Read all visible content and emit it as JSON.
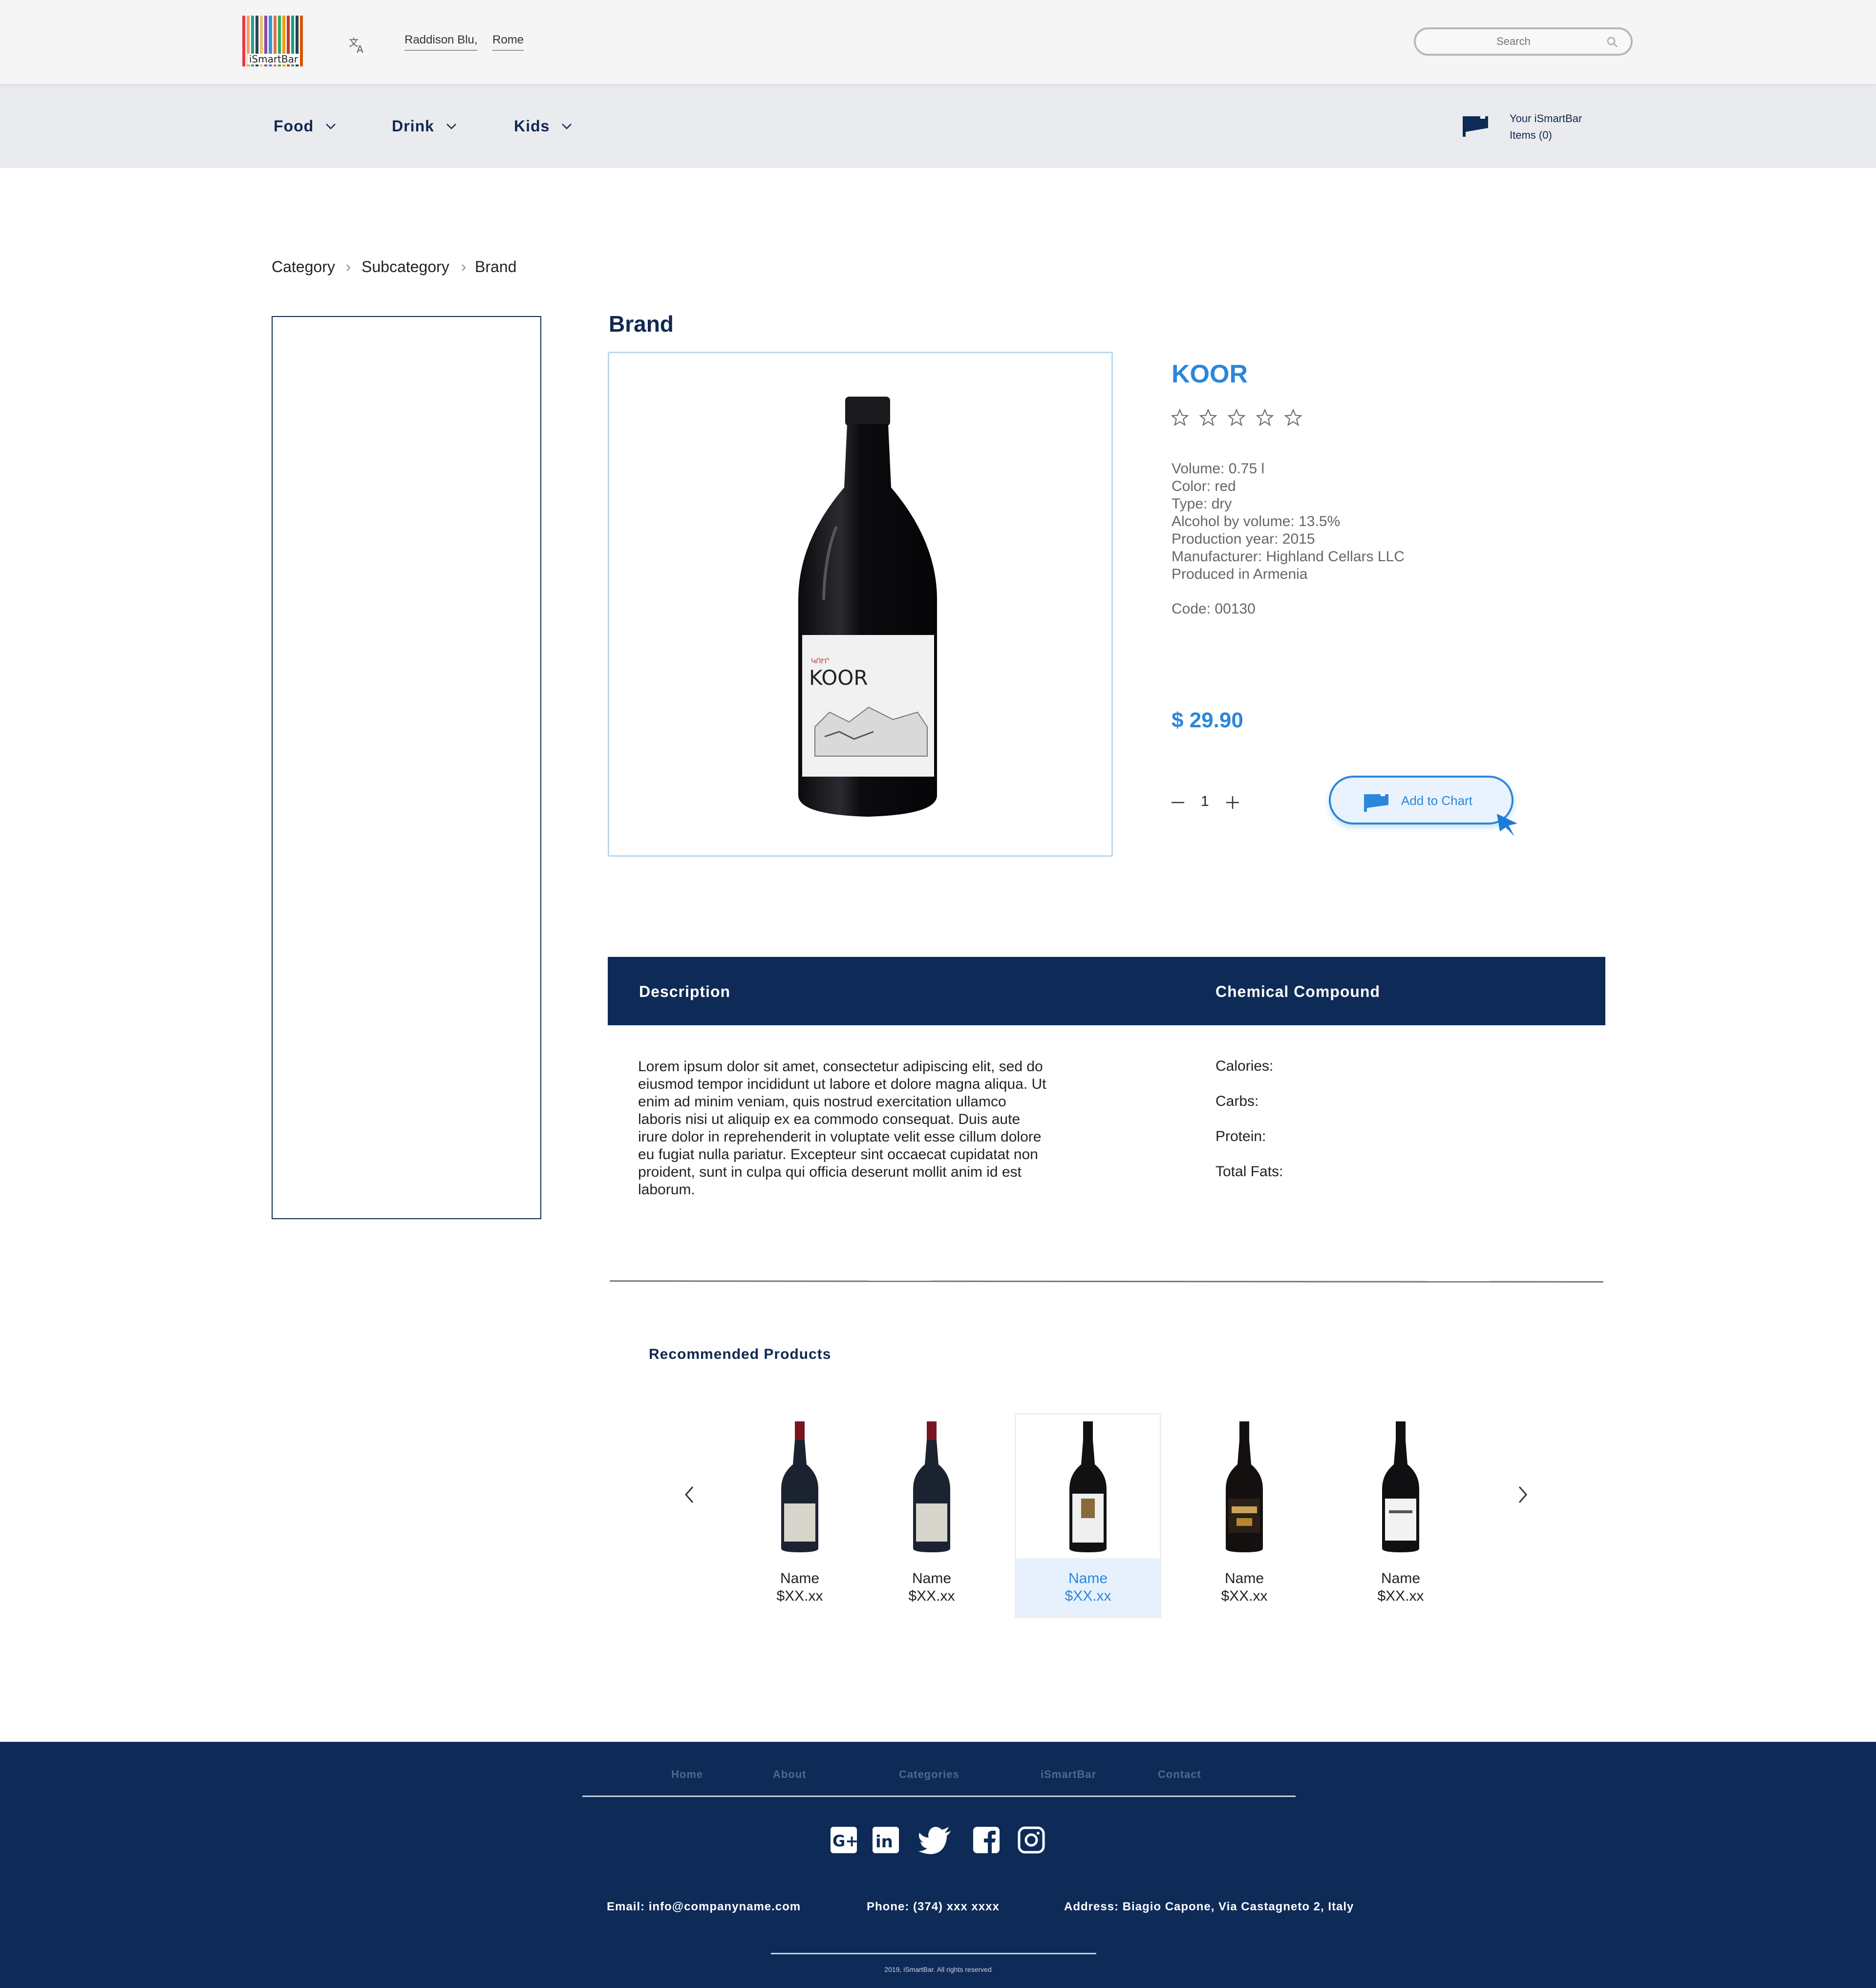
{
  "header": {
    "logo_text": "iSmartBar",
    "location_hotel": "Raddison Blu,",
    "location_city": "Rome",
    "search_placeholder": "Search"
  },
  "nav": {
    "items": [
      {
        "label": "Food"
      },
      {
        "label": "Drink"
      },
      {
        "label": "Kids"
      }
    ],
    "cart_title": "Your iSmartBar",
    "cart_items": "Items (0)"
  },
  "breadcrumb": [
    "Category",
    "Subcategory",
    "Brand"
  ],
  "product": {
    "brand_heading": "Brand",
    "name": "KOOR",
    "rating": 0,
    "rating_max": 5,
    "specs": [
      "Volume: 0.75 l",
      "Color: red",
      "Type: dry",
      "Alcohol by volume: 13.5%",
      "Production year: 2015",
      "Manufacturer: Highland Cellars LLC",
      "Produced in Armenia"
    ],
    "code": "Code: 00130",
    "price": "$ 29.90",
    "quantity": "1",
    "add_button": "Add to Chart",
    "label_brand": "KOOR"
  },
  "tabs": {
    "description_label": "Description",
    "chemical_label": "Chemical Compound",
    "description_text": "Lorem ipsum dolor sit amet, consectetur adipiscing elit, sed do eiusmod tempor incididunt ut labore et dolore magna aliqua. Ut enim ad minim veniam, quis nostrud exercitation ullamco laboris nisi ut aliquip ex ea commodo consequat. Duis aute irure dolor in reprehenderit in voluptate velit esse cillum dolore eu fugiat nulla pariatur. Excepteur sint occaecat cupidatat non proident, sunt in culpa qui officia deserunt mollit anim id est laborum.",
    "chemical": [
      "Calories:",
      "Carbs:",
      "Protein:",
      "Total Fats:"
    ]
  },
  "recommended": {
    "title": "Recommended Products",
    "items": [
      {
        "name": "Name",
        "price": "$XX.xx",
        "active": false
      },
      {
        "name": "Name",
        "price": "$XX.xx",
        "active": false
      },
      {
        "name": "Name",
        "price": "$XX.xx",
        "active": true
      },
      {
        "name": "Name",
        "price": "$XX.xx",
        "active": false
      },
      {
        "name": "Name",
        "price": "$XX.xx",
        "active": false
      }
    ]
  },
  "footer": {
    "links": [
      "Home",
      "About",
      "Categories",
      "iSmartBar",
      "Contact"
    ],
    "social_icons": [
      "google-plus-icon",
      "linkedin-icon",
      "twitter-icon",
      "facebook-icon",
      "instagram-icon"
    ],
    "email": "Email: info@companyname.com",
    "phone": "Phone: (374) xxx xxxx",
    "address": "Address: Biagio Capone, Via Castagneto 2, Italy",
    "copyright": "2019, iSmartBar. All rights reserved"
  },
  "colors": {
    "navy": "#0e2b58",
    "accent_blue": "#2b86dc",
    "nav_bg": "#eaebee"
  }
}
